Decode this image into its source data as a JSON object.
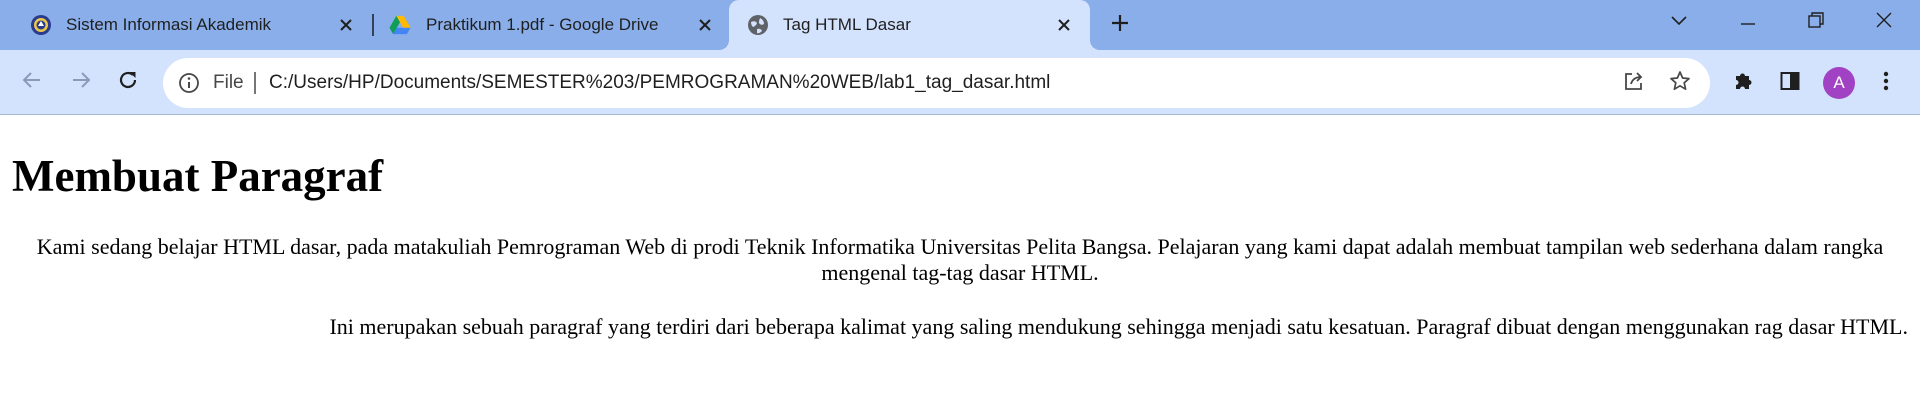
{
  "browser": {
    "tabs": [
      {
        "title": "Sistem Informasi Akademik",
        "favicon": "university-seal-icon"
      },
      {
        "title": "Praktikum 1.pdf - Google Drive",
        "favicon": "google-drive-icon"
      },
      {
        "title": "Tag HTML Dasar",
        "favicon": "globe-icon",
        "active": true
      }
    ],
    "address_bar": {
      "scheme_label": "File",
      "url": "C:/Users/HP/Documents/SEMESTER%203/PEMROGRAMAN%20WEB/lab1_tag_dasar.html"
    },
    "profile_initial": "A",
    "colors": {
      "tabstrip": "#8aaee9",
      "toolbar": "#d3e3fd",
      "avatar": "#a142c4"
    }
  },
  "page": {
    "heading": "Membuat Paragraf",
    "paragraph_1": "Kami sedang belajar HTML dasar, pada matakuliah Pemrograman Web di prodi Teknik Informatika Universitas Pelita Bangsa. Pelajaran yang kami dapat adalah membuat tampilan web sederhana dalam rangka mengenal tag-tag dasar HTML.",
    "paragraph_2": "Ini merupakan sebuah paragraf yang terdiri dari beberapa kalimat yang saling mendukung sehingga menjadi satu kesatuan. Paragraf dibuat dengan menggunakan rag dasar HTML."
  }
}
